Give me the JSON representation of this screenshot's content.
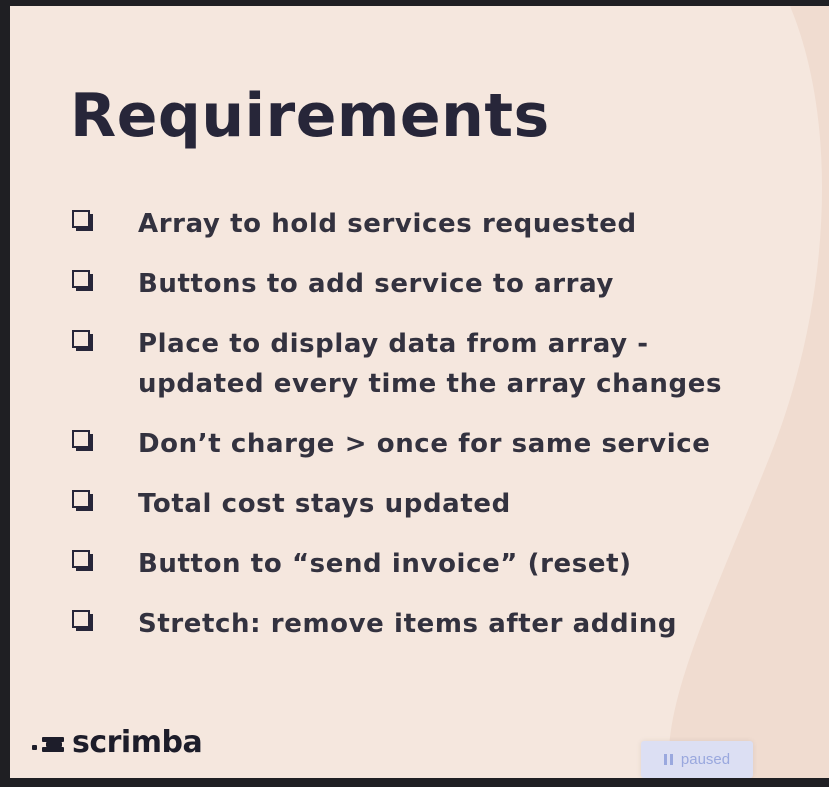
{
  "slide": {
    "title": "Requirements",
    "requirements": [
      "Array to hold services requested",
      "Buttons to add service to array",
      "Place to display data from array -",
      "updated every time the array changes",
      "Don’t charge > once for same service",
      "Total cost stays updated",
      "Button to “send invoice” (reset)",
      "Stretch: remove items after adding"
    ],
    "checkbox_icon": "checkbox-icon",
    "colors": {
      "background": "#f5e7de",
      "accent_wave": "#f0dcd0",
      "text": "#272639"
    }
  },
  "brand": {
    "logo_text": "scrimba"
  },
  "player": {
    "status_label": "paused",
    "status_icon": "pause-icon"
  }
}
